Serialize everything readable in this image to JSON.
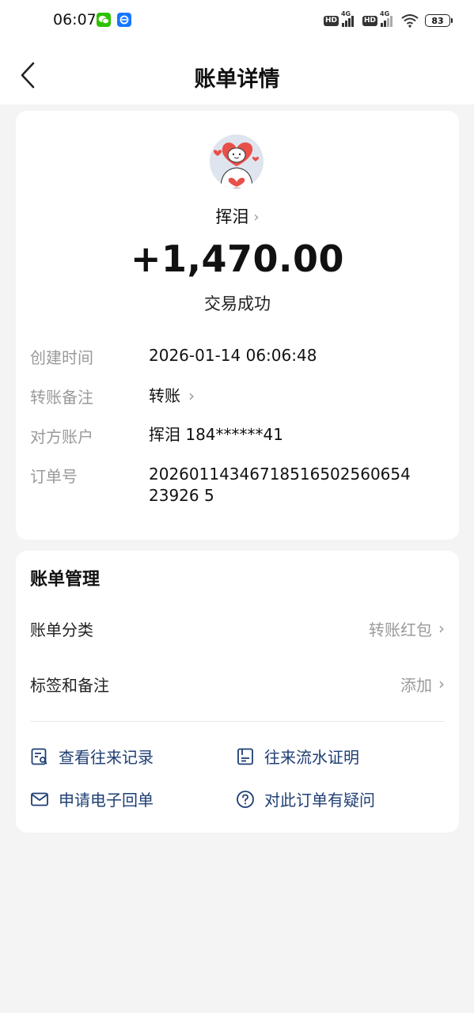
{
  "status_bar": {
    "time": "06:07",
    "network_1": "4G",
    "network_2": "4G",
    "hd_1": "HD",
    "hd_2": "HD",
    "battery": "83"
  },
  "header": {
    "title": "账单详情"
  },
  "transaction": {
    "counterparty_name": "挥泪",
    "amount": "+1,470.00",
    "status": "交易成功"
  },
  "details": {
    "rows": [
      {
        "label": "创建时间",
        "value": "2026-01-14 06:06:48"
      },
      {
        "label": "转账备注",
        "value": "转账"
      },
      {
        "label": "对方账户",
        "value": "挥泪 184******41"
      },
      {
        "label": "订单号",
        "value": "2026011434671851650256065423926 5"
      }
    ]
  },
  "management": {
    "title": "账单管理",
    "category_label": "账单分类",
    "category_value": "转账红包",
    "tags_label": "标签和备注",
    "tags_value": "添加"
  },
  "actions": {
    "view_records": "查看往来记录",
    "flow_certificate": "往来流水证明",
    "e_receipt": "申请电子回单",
    "question": "对此订单有疑问"
  },
  "colors": {
    "accent_text": "#1f3f73",
    "background": "#f4f4f4",
    "card": "#ffffff"
  }
}
